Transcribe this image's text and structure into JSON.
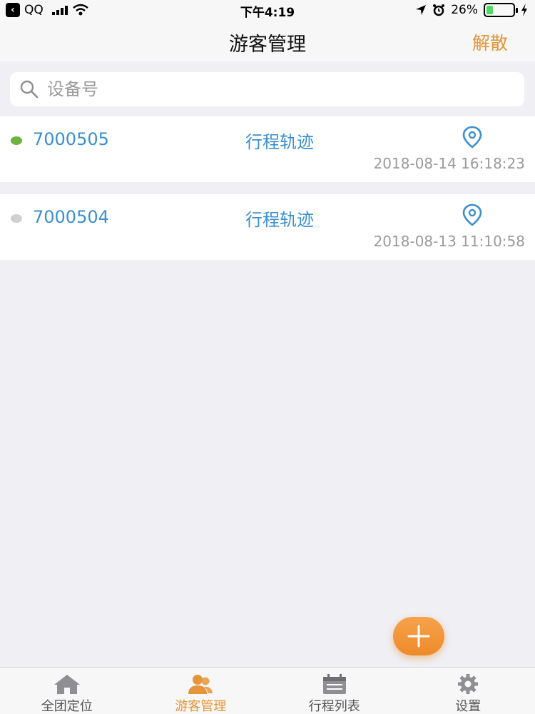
{
  "status_bar": {
    "back_app": "QQ",
    "time": "下午4:19",
    "battery": "26%",
    "battery_level": 0.26
  },
  "nav": {
    "title": "游客管理",
    "action": "解散"
  },
  "search": {
    "placeholder": "设备号",
    "value": ""
  },
  "devices": [
    {
      "id": "7000505",
      "link": "行程轨迹",
      "time": "2018-08-14 16:18:23",
      "status_color": "#6db33f"
    },
    {
      "id": "7000504",
      "link": "行程轨迹",
      "time": "2018-08-13 11:10:58",
      "status_color": "#d0d0d0"
    }
  ],
  "colors": {
    "accent": "#e6953a",
    "link": "#3a8fd0"
  },
  "tabs": [
    {
      "label": "全团定位",
      "icon": "home-icon",
      "active": false
    },
    {
      "label": "游客管理",
      "icon": "users-icon",
      "active": true
    },
    {
      "label": "行程列表",
      "icon": "calendar-icon",
      "active": false
    },
    {
      "label": "设置",
      "icon": "gear-icon",
      "active": false
    }
  ]
}
